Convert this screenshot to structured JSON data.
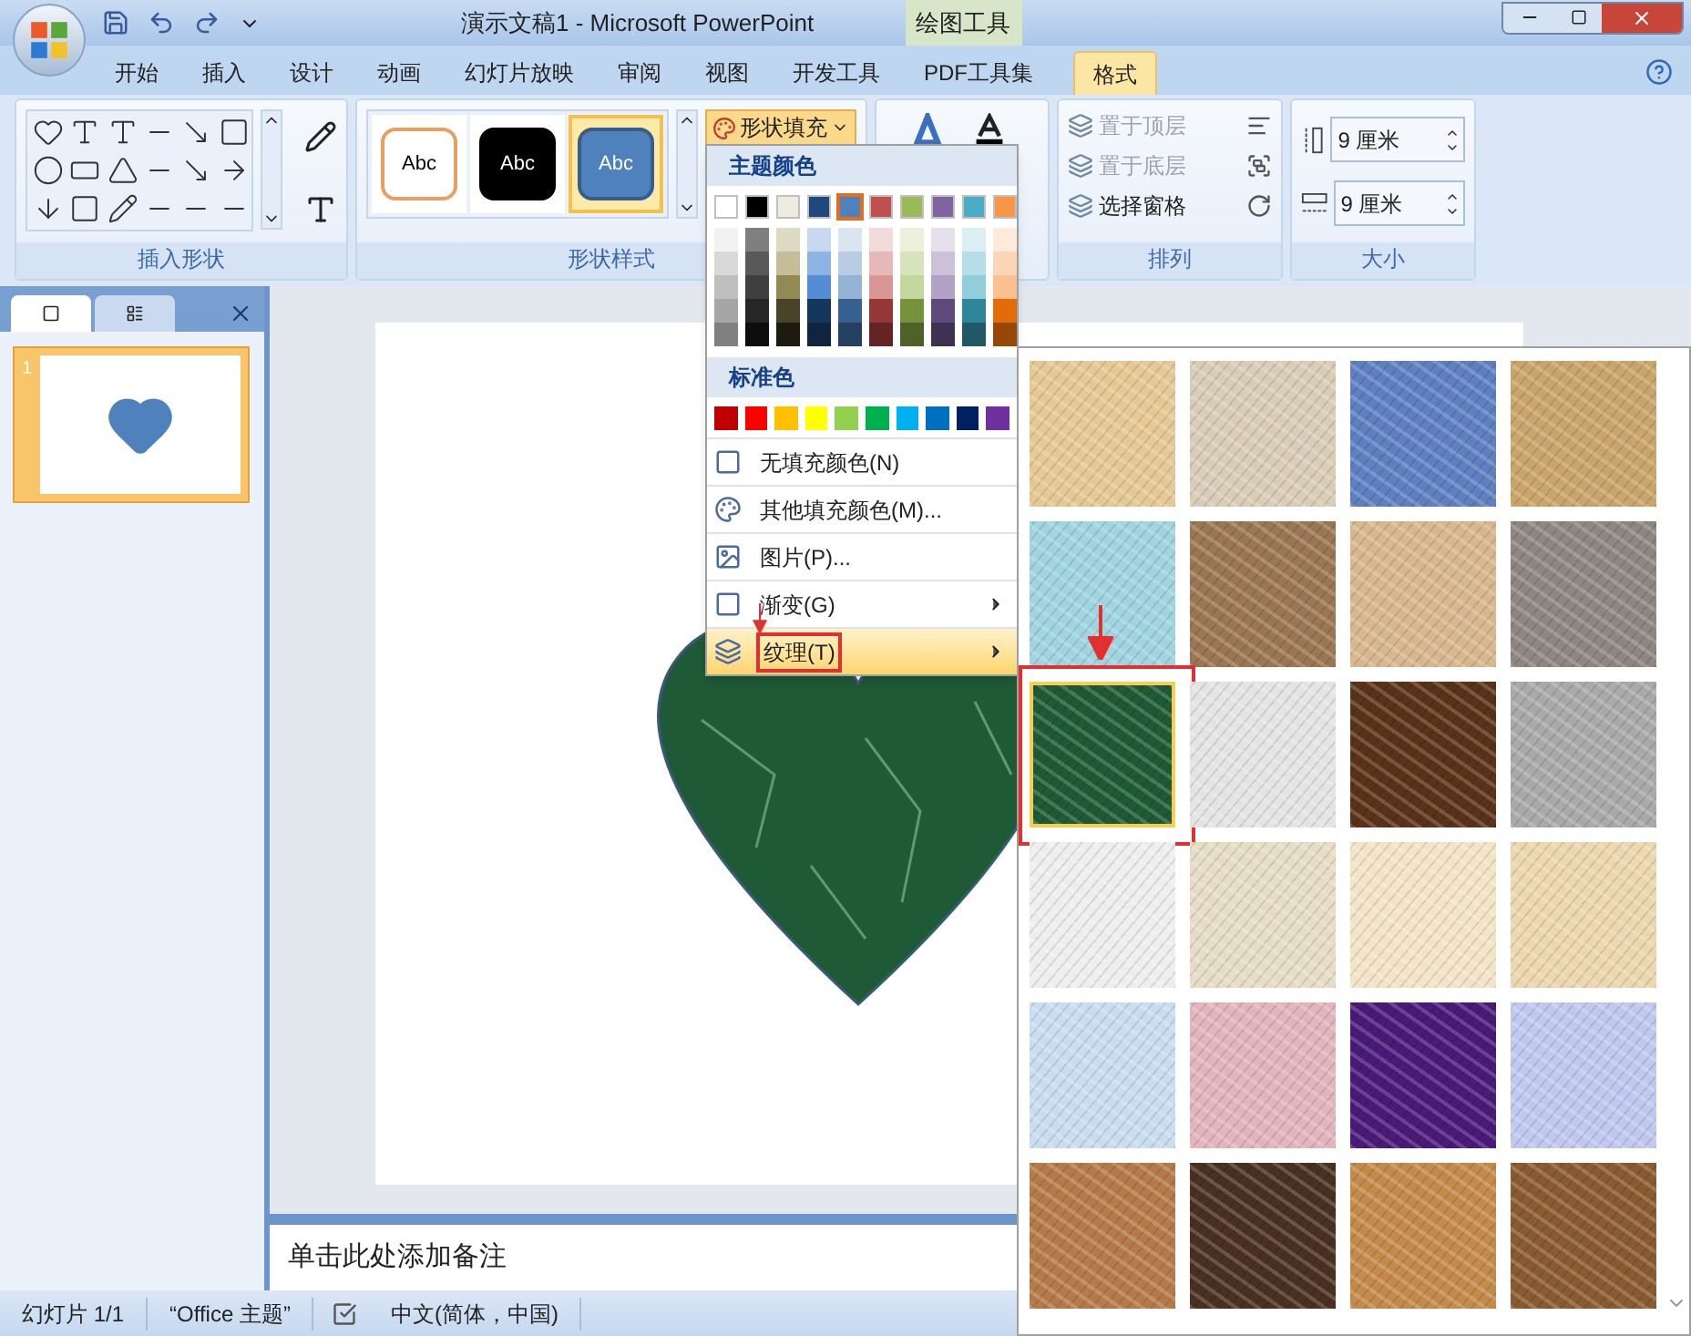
{
  "window": {
    "title": "演示文稿1 - Microsoft PowerPoint",
    "context_label": "绘图工具"
  },
  "tabs": [
    {
      "label": "开始",
      "selected": false
    },
    {
      "label": "插入",
      "selected": false
    },
    {
      "label": "设计",
      "selected": false
    },
    {
      "label": "动画",
      "selected": false
    },
    {
      "label": "幻灯片放映",
      "selected": false
    },
    {
      "label": "审阅",
      "selected": false
    },
    {
      "label": "视图",
      "selected": false
    },
    {
      "label": "开发工具",
      "selected": false
    },
    {
      "label": "PDF工具集",
      "selected": false
    },
    {
      "label": "格式",
      "selected": true
    }
  ],
  "ribbon": {
    "groups": [
      "插入形状",
      "形状样式",
      "排列",
      "大小"
    ],
    "shape_styles": [
      {
        "label": "Abc",
        "kind": "outline",
        "selected": false
      },
      {
        "label": "Abc",
        "kind": "dark",
        "selected": false
      },
      {
        "label": "Abc",
        "kind": "filled",
        "selected": true
      }
    ],
    "shape_fill": "形状填充",
    "arrange": [
      {
        "label": "置于顶层",
        "disabled": true
      },
      {
        "label": "置于底层",
        "disabled": true
      },
      {
        "label": "选择窗格",
        "disabled": false
      }
    ],
    "size": [
      {
        "value": "9 厘米"
      },
      {
        "value": "9 厘米"
      }
    ]
  },
  "fill_menu": {
    "theme_heading": "主题颜色",
    "theme_colors": [
      {
        "color": "#ffffff",
        "selected": false,
        "shades": [
          {
            "color": "#f2f2f2"
          },
          {
            "color": "#d9d9d9"
          },
          {
            "color": "#bfbfbf"
          },
          {
            "color": "#a6a6a6"
          },
          {
            "color": "#808080"
          }
        ]
      },
      {
        "color": "#000000",
        "selected": false,
        "shades": [
          {
            "color": "#7f7f7f"
          },
          {
            "color": "#595959"
          },
          {
            "color": "#3f3f3f"
          },
          {
            "color": "#262626"
          },
          {
            "color": "#0d0d0d"
          }
        ]
      },
      {
        "color": "#eeece1",
        "selected": false,
        "shades": [
          {
            "color": "#ddd9c3"
          },
          {
            "color": "#c4bd97"
          },
          {
            "color": "#938953"
          },
          {
            "color": "#494429"
          },
          {
            "color": "#1d1b10"
          }
        ]
      },
      {
        "color": "#1f497d",
        "selected": false,
        "shades": [
          {
            "color": "#c6d9f0"
          },
          {
            "color": "#8db3e2"
          },
          {
            "color": "#548dd4"
          },
          {
            "color": "#17365d"
          },
          {
            "color": "#0f243e"
          }
        ]
      },
      {
        "color": "#4f81bd",
        "selected": true,
        "shades": [
          {
            "color": "#dbe5f1"
          },
          {
            "color": "#b8cce4"
          },
          {
            "color": "#95b3d7"
          },
          {
            "color": "#366092"
          },
          {
            "color": "#244061"
          }
        ]
      },
      {
        "color": "#c0504d",
        "selected": false,
        "shades": [
          {
            "color": "#f2dcdb"
          },
          {
            "color": "#e5b9b7"
          },
          {
            "color": "#d99694"
          },
          {
            "color": "#953734"
          },
          {
            "color": "#632423"
          }
        ]
      },
      {
        "color": "#9bbb59",
        "selected": false,
        "shades": [
          {
            "color": "#ebf1dd"
          },
          {
            "color": "#d7e3bc"
          },
          {
            "color": "#c3d69b"
          },
          {
            "color": "#76923c"
          },
          {
            "color": "#4f6128"
          }
        ]
      },
      {
        "color": "#8064a2",
        "selected": false,
        "shades": [
          {
            "color": "#e5e0ec"
          },
          {
            "color": "#ccc1d9"
          },
          {
            "color": "#b2a2c7"
          },
          {
            "color": "#5f497a"
          },
          {
            "color": "#3f3151"
          }
        ]
      },
      {
        "color": "#4bacc6",
        "selected": false,
        "shades": [
          {
            "color": "#dbeef3"
          },
          {
            "color": "#b7dde8"
          },
          {
            "color": "#92cddc"
          },
          {
            "color": "#31859b"
          },
          {
            "color": "#205867"
          }
        ]
      },
      {
        "color": "#f79646",
        "selected": false,
        "shades": [
          {
            "color": "#fdeada"
          },
          {
            "color": "#fbd5b5"
          },
          {
            "color": "#fac08f"
          },
          {
            "color": "#e36c09"
          },
          {
            "color": "#974806"
          }
        ]
      }
    ],
    "standard_heading": "标准色",
    "standard_colors": [
      {
        "color": "#c00000"
      },
      {
        "color": "#ff0000"
      },
      {
        "color": "#ffc000"
      },
      {
        "color": "#ffff00"
      },
      {
        "color": "#92d050"
      },
      {
        "color": "#00b050"
      },
      {
        "color": "#00b0f0"
      },
      {
        "color": "#0070c0"
      },
      {
        "color": "#002060"
      },
      {
        "color": "#7030a0"
      }
    ],
    "items": [
      {
        "label": "无填充颜色(N)",
        "kind": "none",
        "submenu": false,
        "selected": false,
        "highlighted": false
      },
      {
        "label": "其他填充颜色(M)...",
        "kind": "palette",
        "submenu": false,
        "selected": false,
        "highlighted": false
      },
      {
        "label": "图片(P)...",
        "kind": "picture",
        "submenu": false,
        "selected": false,
        "highlighted": false
      },
      {
        "label": "渐变(G)",
        "kind": "gradient",
        "submenu": true,
        "selected": false,
        "highlighted": false
      },
      {
        "label": "纹理(T)",
        "kind": "texture",
        "submenu": true,
        "selected": true,
        "highlighted": true
      }
    ]
  },
  "texture_gallery": {
    "textures": [
      {
        "color": "#e6c894",
        "selected": false,
        "highlighted": false
      },
      {
        "color": "#d9cdb8",
        "selected": false,
        "highlighted": false
      },
      {
        "color": "#5e7fc0",
        "selected": false,
        "highlighted": false
      },
      {
        "color": "#c9a56a",
        "selected": false,
        "highlighted": false
      },
      {
        "color": "#9fd4e0",
        "selected": false,
        "highlighted": false
      },
      {
        "color": "#9b7652",
        "selected": false,
        "highlighted": false
      },
      {
        "color": "#d8b78e",
        "selected": false,
        "highlighted": false
      },
      {
        "color": "#8e8680",
        "selected": false,
        "highlighted": false
      },
      {
        "color": "#1f5a36",
        "selected": true,
        "highlighted": true
      },
      {
        "color": "#e4e4e4",
        "selected": false,
        "highlighted": false
      },
      {
        "color": "#5a3218",
        "selected": false,
        "highlighted": false
      },
      {
        "color": "#a9a9a9",
        "selected": false,
        "highlighted": false
      },
      {
        "color": "#eeeeee",
        "selected": false,
        "highlighted": false
      },
      {
        "color": "#e7dcc6",
        "selected": false,
        "highlighted": false
      },
      {
        "color": "#f3e4c8",
        "selected": false,
        "highlighted": false
      },
      {
        "color": "#ecd7ae",
        "selected": false,
        "highlighted": false
      },
      {
        "color": "#c9ddf0",
        "selected": false,
        "highlighted": false
      },
      {
        "color": "#e2b4bc",
        "selected": false,
        "highlighted": false
      },
      {
        "color": "#4a1a78",
        "selected": false,
        "highlighted": false
      },
      {
        "color": "#c0c8f0",
        "selected": false,
        "highlighted": false
      },
      {
        "color": "#b57a48",
        "selected": false,
        "highlighted": false
      },
      {
        "color": "#4a3020",
        "selected": false,
        "highlighted": false
      },
      {
        "color": "#c48a4a",
        "selected": false,
        "highlighted": false
      },
      {
        "color": "#8a5a30",
        "selected": false,
        "highlighted": false
      }
    ]
  },
  "slide_panel": {
    "slides": [
      {
        "number": "1",
        "selected": true
      }
    ]
  },
  "notes": {
    "placeholder": "单击此处添加备注"
  },
  "status_bar": [
    "幻灯片 1/1",
    "“Office 主题”",
    "中文(简体，中国)"
  ]
}
